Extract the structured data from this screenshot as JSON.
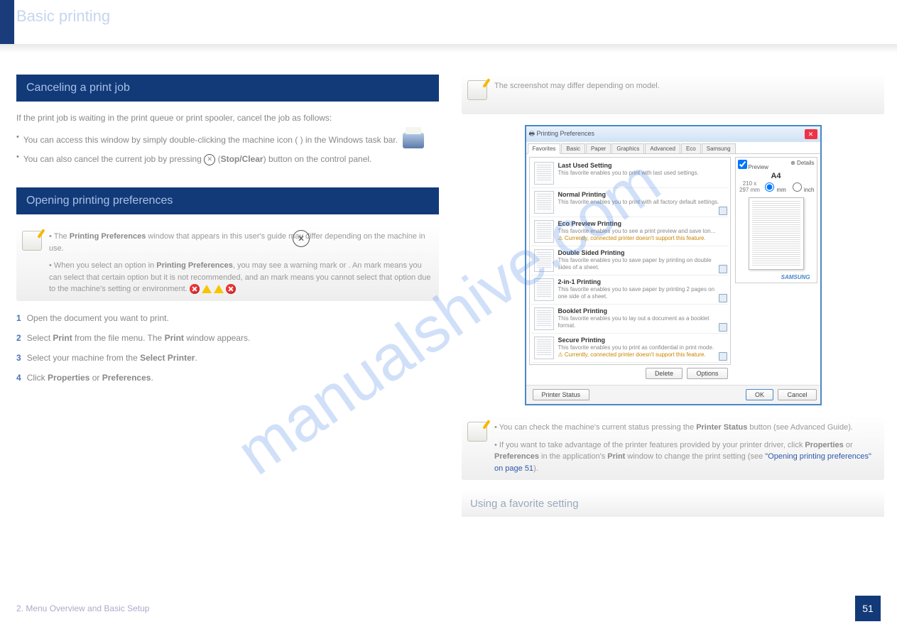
{
  "header": {
    "title": "Basic printing"
  },
  "watermark": "manualshive.com",
  "col1": {
    "sec1": {
      "title": "Canceling a print job",
      "intro": "If the print job is waiting in the print queue or print spooler, cancel the job as follows:",
      "li1": "You can access this window by simply double-clicking the machine icon (       ) in the Windows task bar.",
      "li2_a": "You can also cancel the current job by pressing ",
      "li2_b": " (",
      "li2_c": "Stop/Clear",
      "li2_d": ") button on the control panel."
    },
    "sec2": {
      "title": "Opening printing preferences",
      "note_a": "The ",
      "note_b": "Printing Preferences",
      "note_c": " window that appears in this user's guide may differ depending on the machine in use.",
      "note2_a": "When you select an option in ",
      "note2_b": "Printing Preferences",
      "note2_c": ", you may see a warning mark      or     . An      mark means you can select that certain option but it is not recommended, and an      mark means you cannot select that option due to the machine's setting or environment.",
      "s1": {
        "n": "1",
        "t": "Open the document you want to print."
      },
      "s2": {
        "n": "2",
        "a": "Select ",
        "b": "Print",
        "c": " from the file menu. The ",
        "d": "Print",
        "e": " window appears."
      },
      "s3": {
        "n": "3",
        "a": "Select your machine from the ",
        "b": "Select Printer",
        "c": "."
      },
      "s4": {
        "n": "4",
        "a": "Click ",
        "b": "Properties",
        "c": " or ",
        "d": "Preferences",
        "e": "."
      }
    }
  },
  "col2": {
    "note_top": "The screenshot may differ depending on model.",
    "pref": {
      "title": "Printing Preferences",
      "tabs": [
        "Favorites",
        "Basic",
        "Paper",
        "Graphics",
        "Advanced",
        "Eco",
        "Samsung"
      ],
      "items": [
        {
          "name": "Last Used Setting",
          "desc": "This favorite enables you to print with last used settings."
        },
        {
          "name": "Normal Printing",
          "desc": "This favorite enables you to print with all factory default settings.",
          "i": true
        },
        {
          "name": "Eco Preview Printing",
          "desc": "This favorite enables you to see a print preview and save ton...",
          "warn": "Currently, connected printer doesn't support this feature.",
          "eco": true
        },
        {
          "name": "Double Sided Printing",
          "desc": "This favorite enables you to save paper by printing on double sides of a sheet.",
          "i": true
        },
        {
          "name": "2-in-1 Printing",
          "desc": "This favorite enables you to save paper by printing 2 pages on one side of a sheet.",
          "i": true
        },
        {
          "name": "Booklet Printing",
          "desc": "This favorite enables you to lay out a document as a booklet format.",
          "i": true
        },
        {
          "name": "Secure Printing",
          "desc": "This favorite enables you to print as confidential in print mode.",
          "warn": "Currently, connected printer doesn't support this feature.",
          "i": true
        }
      ],
      "delete": "Delete",
      "options": "Options",
      "preview": "Preview",
      "details": "Details",
      "a4": "A4",
      "size": "210 x 297 mm",
      "mm": "mm",
      "inch": "inch",
      "logo": "SAMSUNG",
      "ps": "Printer Status",
      "ok": "OK",
      "cancel": "Cancel"
    },
    "note_mid_a": "You can check the machine's current status pressing the ",
    "note_mid_b": "Printer Status",
    "note_mid_c": " button (see Advanced Guide).",
    "note_mid2_a": "If you want to take advantage of the printer features provided by your printer driver, click ",
    "note_mid2_b": "Properties",
    "note_mid2_c": " or ",
    "note_mid2_d": "Preferences",
    "note_mid2_e": " in the application's ",
    "note_mid2_f": "Print",
    "note_mid2_g": " window to change the print setting (see ",
    "note_mid2_h": "\"Opening printing preferences\" on page 51",
    "fav": {
      "title": "Using a favorite setting"
    }
  },
  "footer": {
    "chapter": "2. Menu Overview and Basic Setup",
    "page": "51"
  }
}
